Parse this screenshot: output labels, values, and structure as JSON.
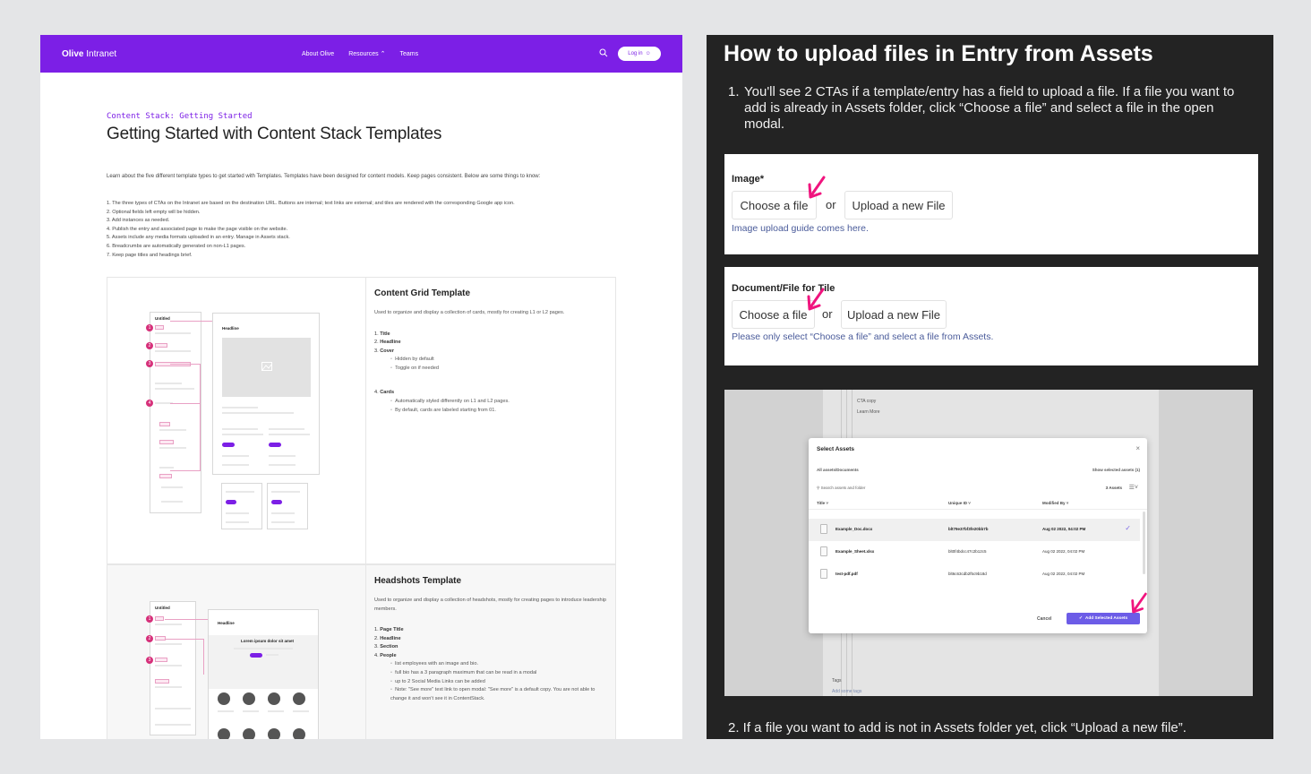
{
  "left": {
    "nav": {
      "brand_bold": "Olive",
      "brand_rest": "Intranet",
      "links": [
        "About Olive",
        "Resources",
        "Teams"
      ],
      "login": "Log in"
    },
    "eyebrow": "Content Stack: Getting Started",
    "title": "Getting Started with Content Stack Templates",
    "intro": "Learn about the five different template types to get started with Templates. Templates have been designed for content models. Keep pages consistent. Below are some things to know:",
    "rules": [
      "1.  The three types of CTAs on the Intranet are based on the destination URL. Buttons are internal; text links are external; and tiles are rendered with the corresponding Google app icon.",
      "2.  Optional fields left empty will be hidden.",
      "3.  Add instances as needed.",
      "4.  Publish the entry and associated page to make the page visible on the website.",
      "5.  Assets include any media formats uploaded in an entry. Manage in Assets stack.",
      "6.  Breadcrumbs are automatically generated on non-L1 pages.",
      "7.  Keep page titles and headings brief."
    ],
    "content_grid": {
      "title": "Content Grid Template",
      "desc": "Used to organize and display a collection of cards, mostly for creating L1 or L2 pages.",
      "items": [
        "1.  ",
        "Title",
        "2.  ",
        "Headline",
        "3.  ",
        "Cover"
      ],
      "cover_sub": [
        "Hidden by default",
        "Toggle on if needed"
      ],
      "cards_num": "4.  ",
      "cards_label": "Cards",
      "cards_sub": [
        "Automatically styled differently on L1 and L2 pages.",
        "By default, cards are labeled starting from 01."
      ]
    },
    "headshots": {
      "title": "Headshots Template",
      "desc": "Used to organize and display a collection of headshots, mostly for creating pages to introduce leadership members.",
      "items": [
        "1.  ",
        "Page Title",
        "2.  ",
        "Headline",
        "3.  ",
        "Section",
        "4.  ",
        "People"
      ],
      "people_sub": [
        "list employees with an image and bio.",
        "full bio has a 3 paragraph maximum that can be read in a modal",
        "up to 2 Social Media Links can be added",
        "Note: \"See more\" text link to open modal: \"See more\" is a default copy. You are not able to change it and won't see it in ContentStack."
      ]
    },
    "wireframe": {
      "pins": [
        "1",
        "2",
        "3",
        "4"
      ],
      "untitled": "Untitled",
      "headline": "Headline",
      "headline2": "Lorem ipsum dolor sit amet"
    }
  },
  "right": {
    "title": "How to upload files in Entry from Assets",
    "step1_num": "1.",
    "step1": "You'll see 2 CTAs if a template/entry has a field to upload a file. If a file you want to add is already in Assets folder, click “Choose a file” and select a file in the open modal.",
    "image_card": {
      "label": "Image*",
      "choose": "Choose a file",
      "or": "or",
      "upload": "Upload a new File",
      "hint": "Image upload guide comes here."
    },
    "doc_card": {
      "label": "Document/File for Tile",
      "choose": "Choose a file",
      "or": "or",
      "upload": "Upload a new File",
      "hint": "Please only select “Choose a file” and select a file from Assets."
    },
    "background": {
      "cta_copy": "CTA copy",
      "learn_more": "Learn More",
      "tags": "Tags",
      "add_tags": "Add some tags"
    },
    "modal": {
      "title": "Select Assets",
      "close": "×",
      "crumb": "All assets/Documents",
      "show_selected": "Show selected assets (1)",
      "search": "Search assets and folder",
      "count": "3 Assets",
      "columns": [
        "Title",
        "Unique ID",
        "Modified By"
      ],
      "rows": [
        {
          "name": "Example_Doc.docx",
          "uid": "blt79e37bf3fe20bb7b",
          "modified": "Aug 02 2022, 04:02 PM",
          "selected": true
        },
        {
          "name": "Example_Sheet.xlsx",
          "uid": "blt0f4bdcc47c2b12c5",
          "modified": "Aug 02 2022, 04:02 PM",
          "selected": false
        },
        {
          "name": "test-pdf.pdf",
          "uid": "blt6c63cdb2f5c9b18d",
          "modified": "Aug 02 2022, 04:02 PM",
          "selected": false
        }
      ],
      "cancel": "Cancel",
      "add": "Add Selected Assets"
    },
    "step2": "2.  If a file you want to add is not in Assets folder yet, click “Upload a new file”."
  },
  "colors": {
    "brand_purple": "#7c1fe6",
    "pin_pink": "#d6307a",
    "arrow_pink": "#f0147e",
    "modal_primary": "#6c5ce7",
    "dark_panel": "#232323"
  },
  "icons": [
    "search-icon",
    "user-icon",
    "chevron-down-icon",
    "image-placeholder-icon",
    "file-icon",
    "check-icon",
    "close-icon",
    "menu-icon",
    "arrow-icon"
  ]
}
